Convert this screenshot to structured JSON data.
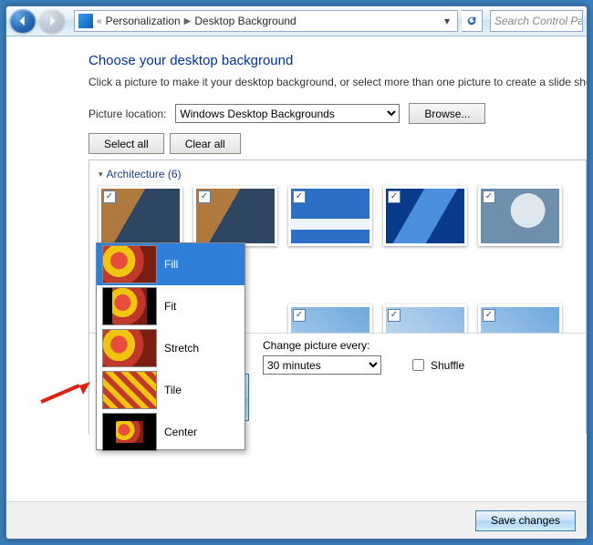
{
  "breadcrumb": {
    "parent": "Personalization",
    "current": "Desktop Background",
    "chevrons": "«"
  },
  "search": {
    "placeholder": "Search Control Pa"
  },
  "heading": "Choose your desktop background",
  "subtext": "Click a picture to make it your desktop background, or select more than one picture to create a slide show.",
  "picture_location_label": "Picture location:",
  "picture_location_value": "Windows Desktop Backgrounds",
  "browse_label": "Browse...",
  "select_all_label": "Select all",
  "clear_all_label": "Clear all",
  "group": {
    "name": "Architecture",
    "count": 6,
    "display": "Architecture (6)"
  },
  "position_options": [
    "Fill",
    "Fit",
    "Stretch",
    "Tile",
    "Center"
  ],
  "position_selected": "Fill",
  "change_every_label": "Change picture every:",
  "change_every_value": "30 minutes",
  "shuffle_label": "Shuffle",
  "save_label": "Save changes"
}
